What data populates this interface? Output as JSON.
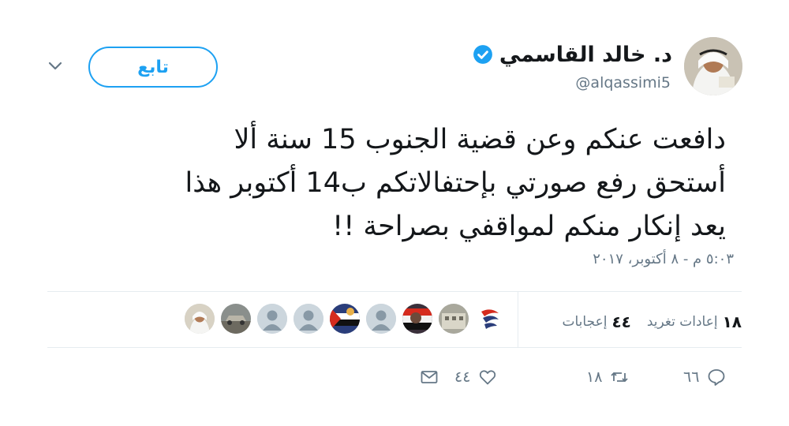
{
  "tweet": {
    "display_name": "د. خالد القاسمي",
    "handle": "@alqassimi5",
    "follow_label": "تابع",
    "text_lines": [
      "دافعت عنكم وعن قضية الجنوب 15 سنة ألا",
      "أستحق رفع صورتي بإحتفالاتكم ب14 أكتوبر هذا",
      "يعد إنكار منكم لمواقفي بصراحة !!"
    ],
    "timestamp": "٥:٠٣ م - ٨ أكتوبر، ٢٠١٧",
    "stats": {
      "retweets_count": "١٨",
      "retweets_label": "إعادات تغريد",
      "likes_count": "٤٤",
      "likes_label": "إعجابات"
    },
    "actions": {
      "reply_count": "٦٦",
      "retweet_count": "١٨",
      "like_count": "٤٤"
    },
    "colors": {
      "accent": "#1da1f2",
      "muted": "#657786",
      "text": "#14171a",
      "divider": "#e6ecf0"
    },
    "likers": [
      {
        "icon": "avatar-flag-icon"
      },
      {
        "icon": "avatar-building-icon"
      },
      {
        "icon": "avatar-person-icon"
      },
      {
        "icon": "avatar-flag-icon"
      },
      {
        "icon": "default-avatar-icon"
      },
      {
        "icon": "avatar-flag-icon"
      },
      {
        "icon": "default-avatar-icon"
      },
      {
        "icon": "default-avatar-icon"
      },
      {
        "icon": "avatar-car-icon"
      },
      {
        "icon": "avatar-person-icon"
      }
    ]
  }
}
